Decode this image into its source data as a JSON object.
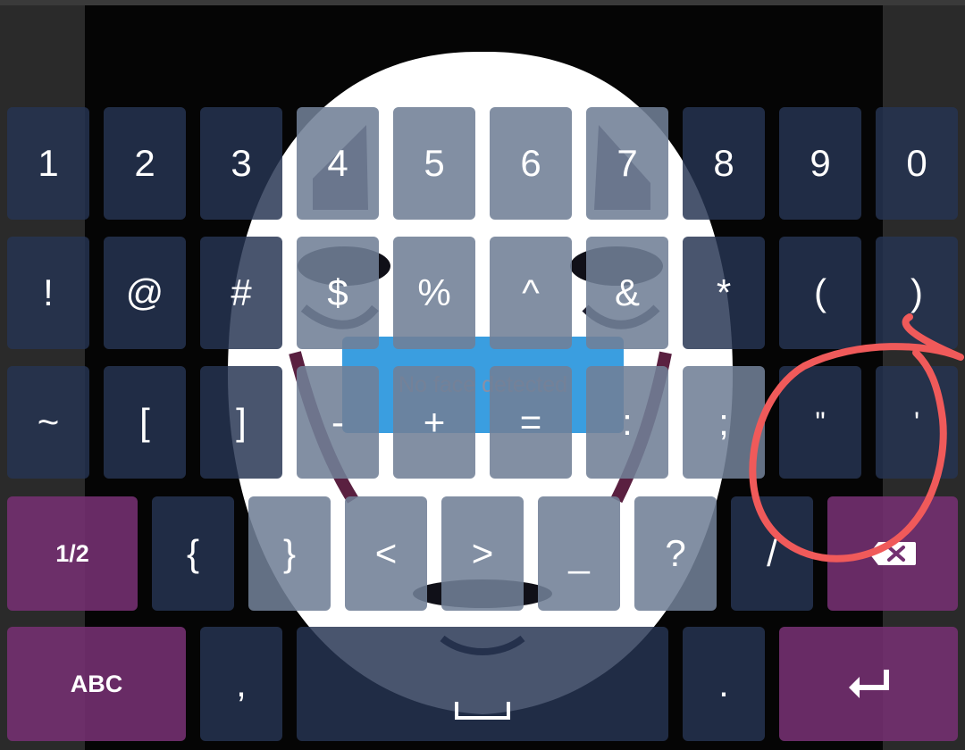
{
  "background": {
    "overlay_text": "No face detected"
  },
  "colors": {
    "key_dark": "#263452",
    "key_light": "#717f96",
    "key_function": "#733070",
    "toast_blue": "#3a9ee0",
    "annotation_red": "#f05a5a"
  },
  "keyboard": {
    "rows": [
      [
        "1",
        "2",
        "3",
        "4",
        "5",
        "6",
        "7",
        "8",
        "9",
        "0"
      ],
      [
        "!",
        "@",
        "#",
        "$",
        "%",
        "^",
        "&",
        "*",
        "(",
        ")"
      ],
      [
        "~",
        "[",
        "]",
        "-",
        "+",
        "=",
        ":",
        ";",
        "\"",
        "'"
      ],
      [
        "1/2",
        "{",
        "}",
        "<",
        ">",
        "_",
        "?",
        "/",
        "backspace-icon"
      ],
      [
        "ABC",
        ",",
        "space-icon",
        ".",
        "enter-icon"
      ]
    ],
    "keys": {
      "r1": [
        "1",
        "2",
        "3",
        "4",
        "5",
        "6",
        "7",
        "8",
        "9",
        "0"
      ],
      "r2": [
        "!",
        "@",
        "#",
        "$",
        "%",
        "^",
        "&",
        "*",
        "(",
        ")"
      ],
      "r3": [
        "~",
        "[",
        "]",
        "-",
        "+",
        "=",
        ":",
        ";",
        "\"",
        "'"
      ],
      "r4": [
        "1/2",
        "{",
        "}",
        "<",
        ">",
        "_",
        "?",
        "/"
      ],
      "r5": [
        "ABC",
        ",",
        "."
      ]
    },
    "icons": {
      "backspace": "backspace-icon",
      "space": "space-icon",
      "enter": "enter-icon"
    }
  }
}
